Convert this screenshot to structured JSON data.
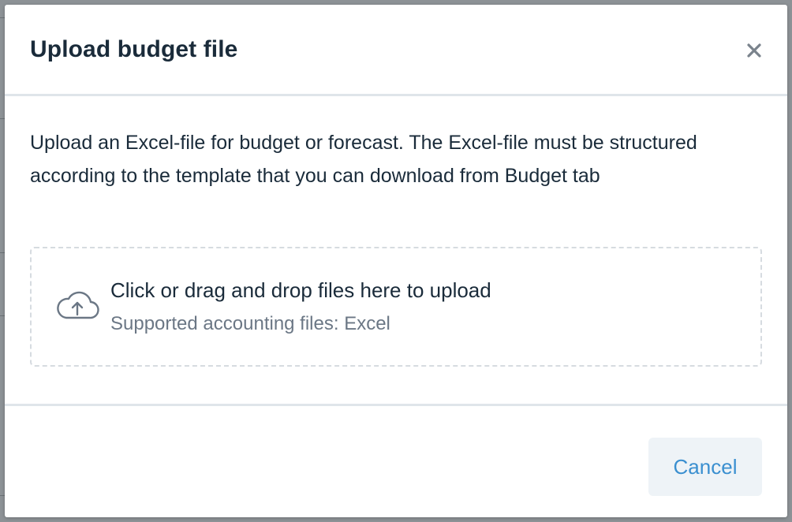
{
  "modal": {
    "title": "Upload budget file",
    "description": "Upload an Excel-file for budget or forecast. The Excel-file must be structured according to the template that you can download from Budget tab",
    "close_icon": "close-icon"
  },
  "dropzone": {
    "icon": "cloud-upload-icon",
    "primary_text": "Click or drag and drop files here to upload",
    "secondary_text": "Supported accounting files: Excel"
  },
  "footer": {
    "cancel_label": "Cancel"
  },
  "colors": {
    "title": "#1a2b3a",
    "muted": "#6b7785",
    "accent": "#3a8fd0",
    "button_bg": "#eef3f7",
    "divider": "#dfe5ea"
  }
}
